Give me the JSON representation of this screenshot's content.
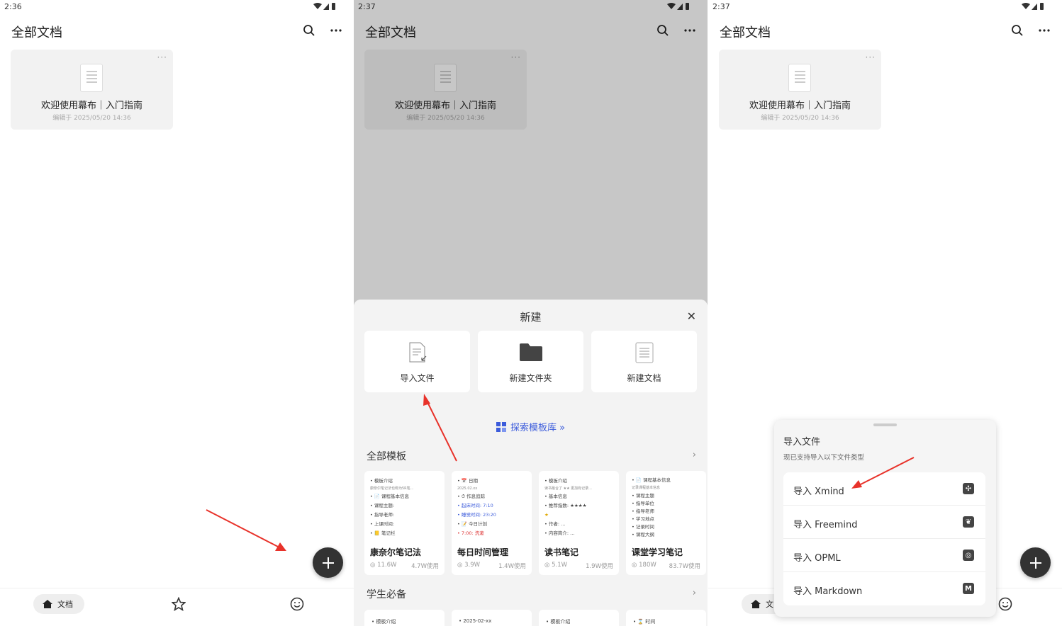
{
  "screens": [
    {
      "status": {
        "time": "2:36"
      },
      "header": {
        "title": "全部文档"
      },
      "doc": {
        "name": "欢迎使用幕布｜入门指南",
        "meta": "编辑于 2025/05/20 14:36"
      },
      "tabbar": {
        "home_label": "文档"
      }
    },
    {
      "status": {
        "time": "2:37"
      },
      "header": {
        "title": "全部文档"
      },
      "doc": {
        "name": "欢迎使用幕布｜入门指南",
        "meta": "编辑于 2025/05/20 14:36"
      },
      "sheet": {
        "title": "新建",
        "options": [
          {
            "label": "导入文件",
            "icon": "import-file-icon"
          },
          {
            "label": "新建文件夹",
            "icon": "folder-icon"
          },
          {
            "label": "新建文档",
            "icon": "document-icon"
          }
        ],
        "explore_label": "探索模板库 »",
        "section_all": "全部模板",
        "section_students": "学生必备",
        "templates": [
          {
            "name": "康奈尔笔记法",
            "views": "11.6W",
            "uses": "4.7W使用",
            "preview": [
              "• 模板介绍",
              "   康奈尔笔记法也称为5R笔...",
              "• 📄 课程基本信息",
              "   • 课程主题:",
              "   • 指导老师:",
              "   • 上课时间:",
              "• 📒 笔记栏"
            ]
          },
          {
            "name": "每日时间管理",
            "views": "3.9W",
            "uses": "1.4W使用",
            "preview": [
              "• 📅 日期",
              "   2025.02.xx",
              "• ⏱ 作息追踪",
              "   • 起床时间: 7:10",
              "   • 睡觉时间: 23:20",
              "• 📝 今日计划",
              "   • 7:00: 洗漱"
            ]
          },
          {
            "name": "读书笔记",
            "views": "5.1W",
            "uses": "1.9W使用",
            "preview": [
              "• 模板介绍",
              "   读书最合了 ★★ 更加有记录...",
              "• 基本信息",
              "   • 推荐指数: ★★★★",
              "   ★",
              "   • 作者: ...",
              "   • 内容简介: ..."
            ]
          },
          {
            "name": "课堂学习笔记",
            "views": "180W",
            "uses": "83.7W使用",
            "preview": [
              "• 📄 课程基本信息",
              "   记录课程基本信息",
              "   • 课程主题",
              "   • 指导单位",
              "   • 指导老师",
              "   • 学习地点",
              "   • 记录时间",
              "   • 课程大纲"
            ]
          }
        ],
        "templates2": [
          "• 模板介绍",
          "• 2025-02-xx",
          "• 模板介绍",
          "• ⌛ 时间"
        ]
      }
    },
    {
      "status": {
        "time": "2:37"
      },
      "header": {
        "title": "全部文档"
      },
      "doc": {
        "name": "欢迎使用幕布｜入门指南",
        "meta": "编辑于 2025/05/20 14:36"
      },
      "tabbar": {
        "home_label": "文"
      },
      "import_panel": {
        "title": "导入文件",
        "subtitle": "现已支持导入以下文件类型",
        "items": [
          {
            "label": "导入 Xmind",
            "icon": "xmind-icon",
            "glyph": "✣"
          },
          {
            "label": "导入 Freemind",
            "icon": "freemind-icon",
            "glyph": "❦"
          },
          {
            "label": "导入 OPML",
            "icon": "opml-icon",
            "glyph": "◎"
          },
          {
            "label": "导入 Markdown",
            "icon": "markdown-icon",
            "glyph": "M"
          }
        ]
      }
    }
  ],
  "colors": {
    "accent": "#3b5bdb",
    "fab": "#333333",
    "arrow": "#e8322a"
  }
}
